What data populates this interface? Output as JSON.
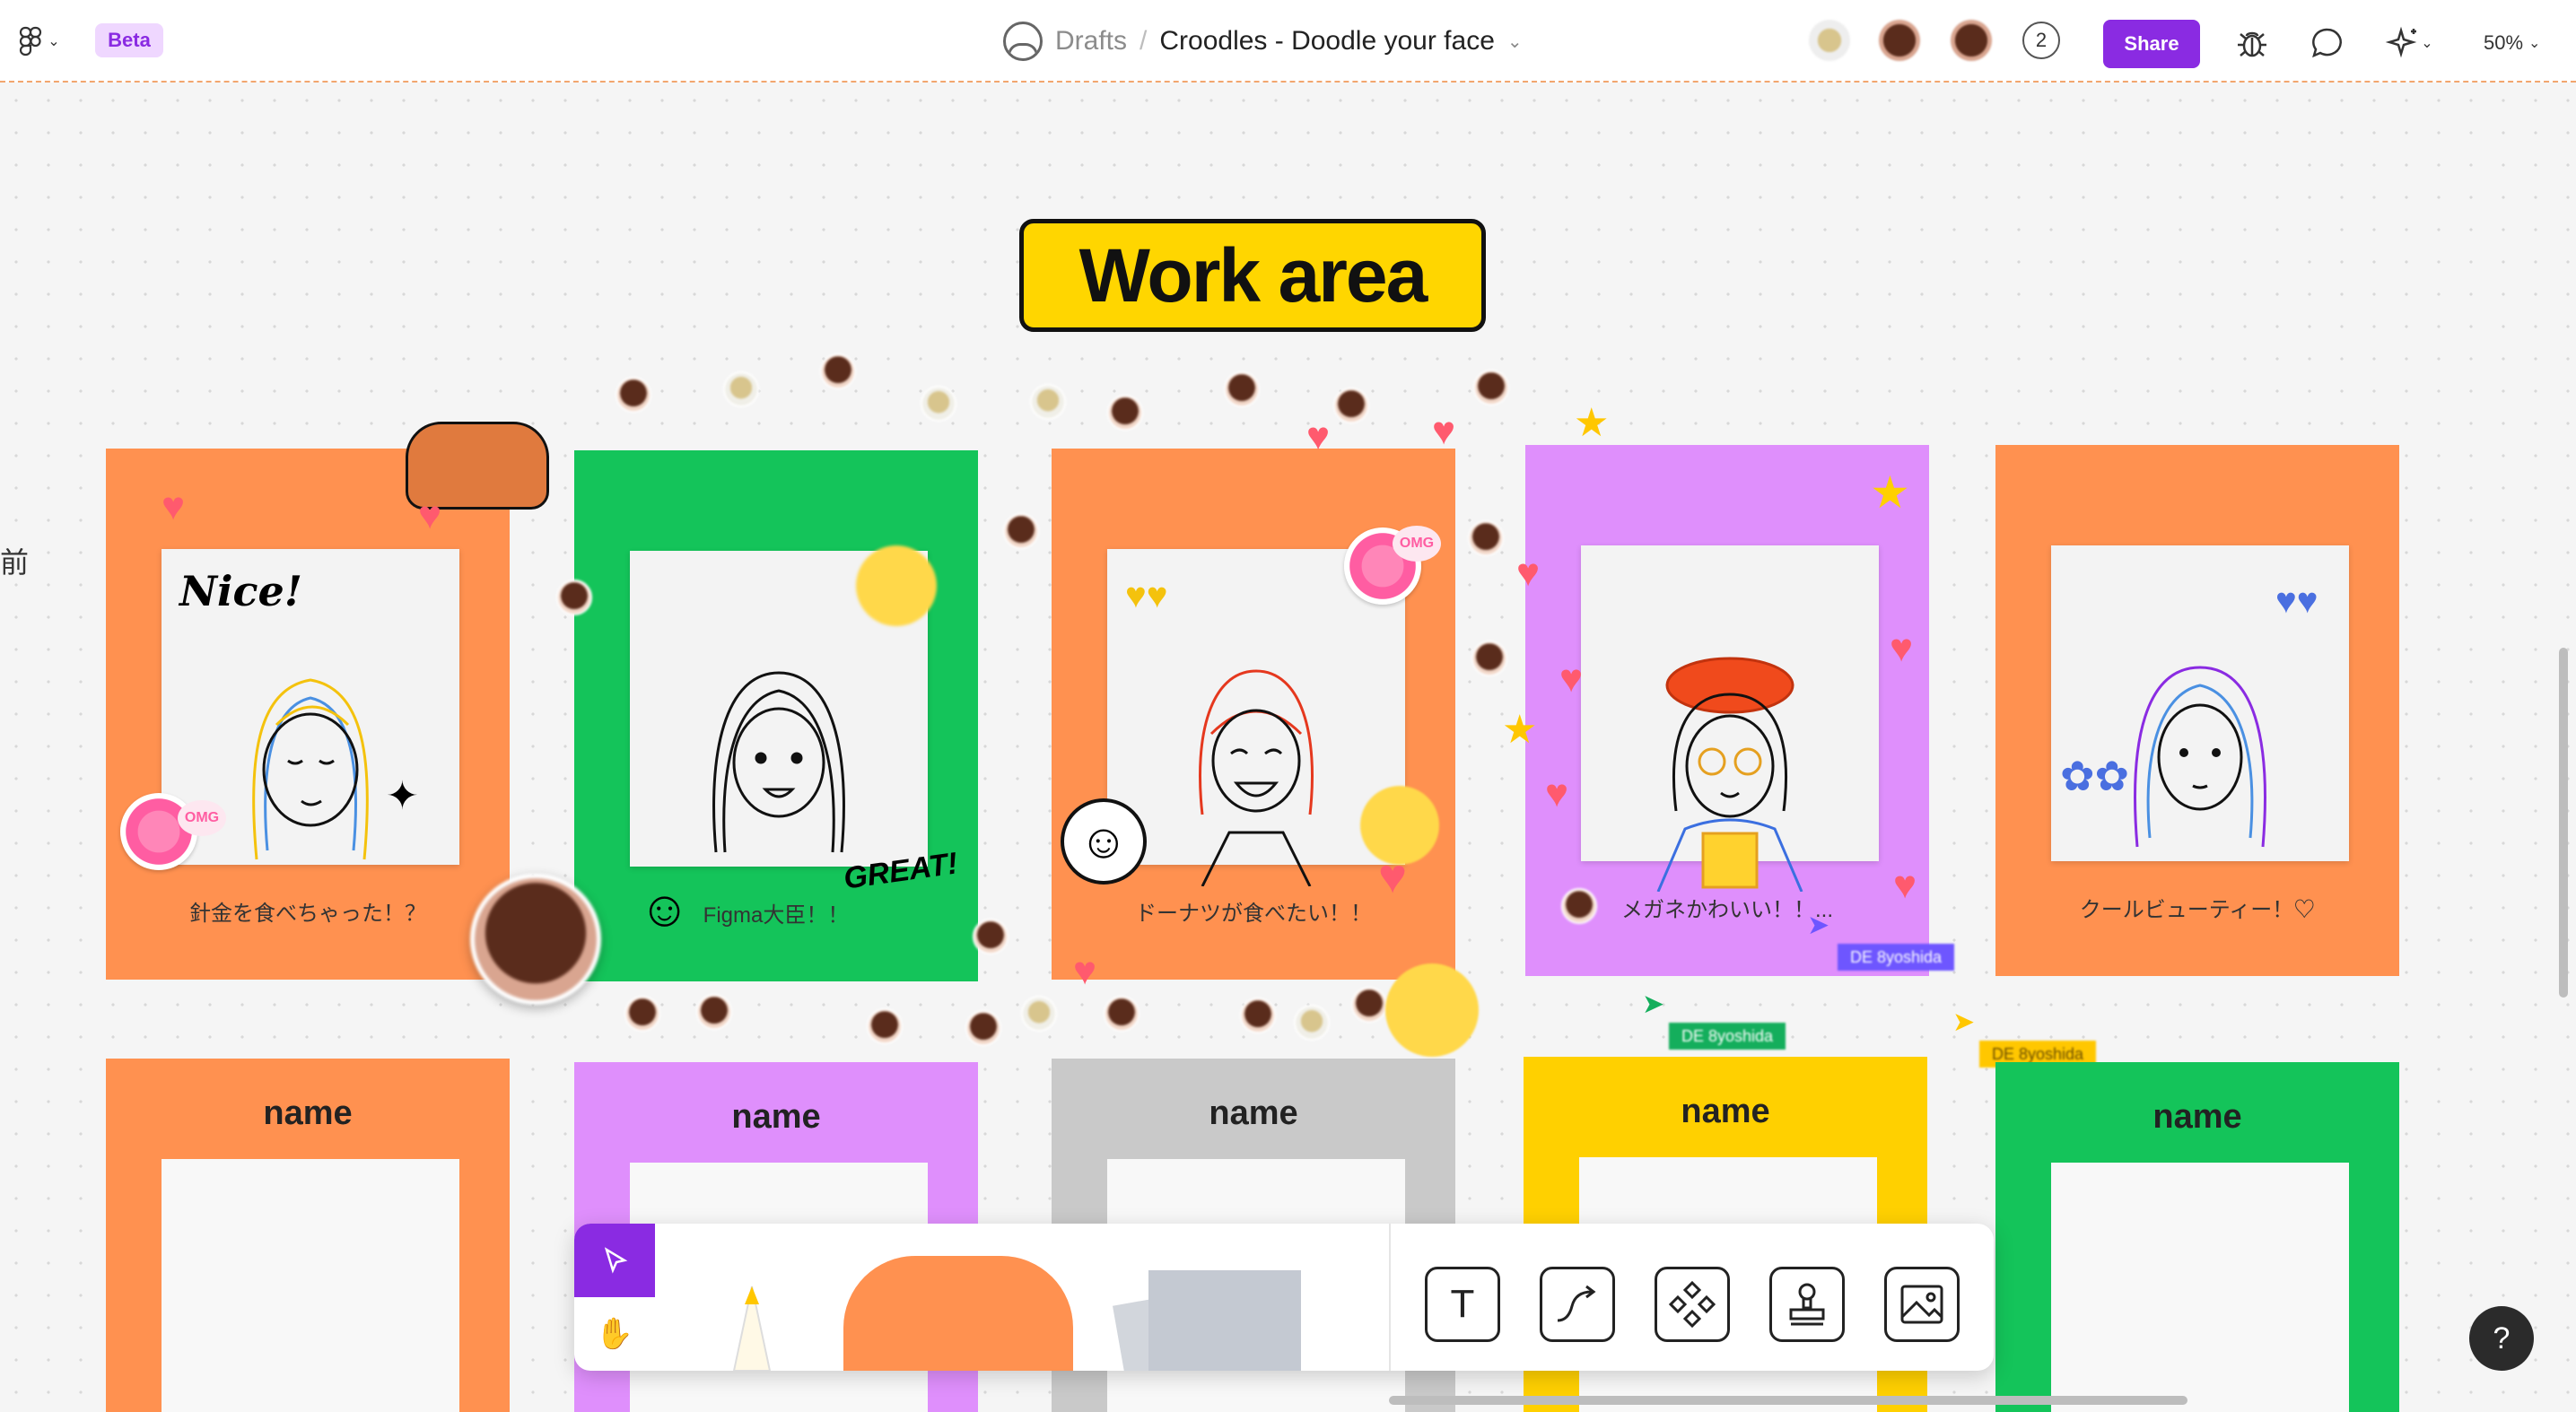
{
  "topbar": {
    "menu_icon": "figma-logo-icon",
    "beta_label": "Beta",
    "breadcrumb": {
      "location": "Drafts",
      "separator": "/",
      "file_name": "Croodles - Doodle your face"
    },
    "collaborator_count": "2",
    "share_label": "Share",
    "zoom_label": "50%",
    "icons": [
      "bug-icon",
      "comment-icon",
      "sparkle-ai-icon"
    ]
  },
  "canvas": {
    "section_title": "Work area",
    "frames": [
      {
        "color": "#ff9150",
        "caption": "針金を食べちゃった！？",
        "doodle": "yellow-blue",
        "overlay": "Nice!"
      },
      {
        "color": "#14c45a",
        "caption": "Figma大臣！！",
        "doodle": "black",
        "overlay": "GREAT!"
      },
      {
        "color": "#ff9150",
        "caption": "ドーナツが食べたい！！",
        "doodle": "red",
        "overlay": ""
      },
      {
        "color": "#df8ffc",
        "caption": "メガネかわいい！！...",
        "doodle": "glasses",
        "overlay": ""
      },
      {
        "color": "#ff9150",
        "caption": "クールビューティー！♡",
        "doodle": "purple",
        "overlay": ""
      }
    ],
    "name_cards": [
      {
        "color": "#ff9150",
        "label": "name"
      },
      {
        "color": "#df8ffc",
        "label": "name"
      },
      {
        "color": "#c9c9c9",
        "label": "name"
      },
      {
        "color": "#ffd000",
        "label": "name"
      },
      {
        "color": "#14c45a",
        "label": "name"
      }
    ],
    "cursor_tags": [
      {
        "label": "DE 8yoshida",
        "color": "#6e56ff"
      },
      {
        "label": "DE 8yoshida",
        "color": "#14ae5c"
      },
      {
        "label": "DE 8yoshida",
        "color": "#ffc700"
      }
    ],
    "sticker_text": {
      "omg": "OMG"
    }
  },
  "toolbar": {
    "tools": [
      "move-tool",
      "hand-tool",
      "pencil-tool",
      "shape-tool",
      "sticky-note-tool",
      "text-tool",
      "connector-tool",
      "component-tool",
      "stamp-tool",
      "image-tool"
    ],
    "text_tool_glyph": "T"
  },
  "help_label": "?",
  "edge_glyph": "前"
}
